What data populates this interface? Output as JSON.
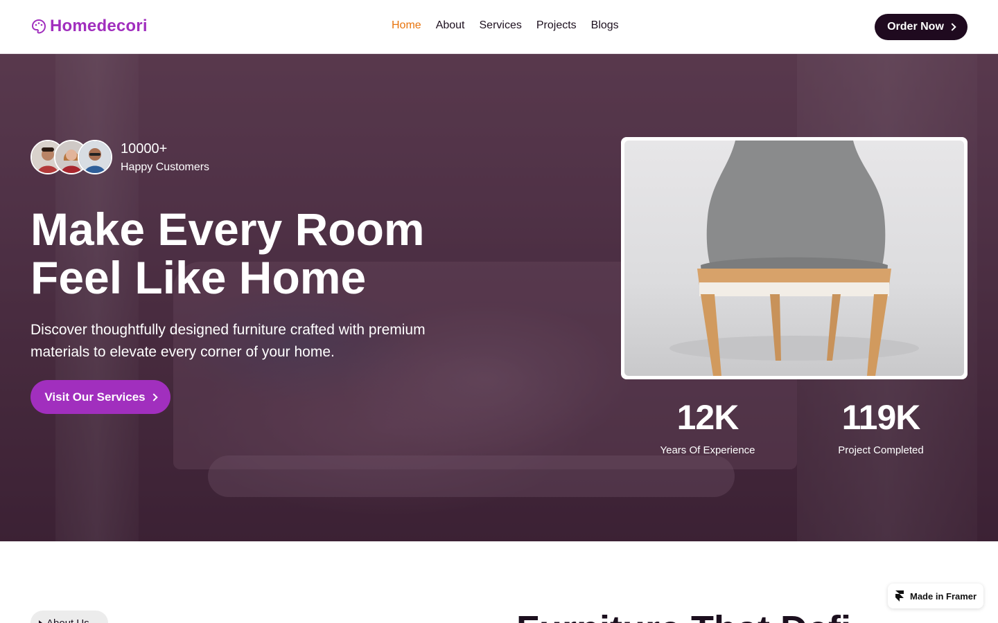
{
  "brand": {
    "name": "Homedecori",
    "accent": "#a12fbe",
    "active_nav": "#e8740d",
    "dark": "#1f0a1f"
  },
  "nav": {
    "items": [
      {
        "label": "Home",
        "active": true
      },
      {
        "label": "About",
        "active": false
      },
      {
        "label": "Services",
        "active": false
      },
      {
        "label": "Projects",
        "active": false
      },
      {
        "label": "Blogs",
        "active": false
      }
    ],
    "order_label": "Order Now"
  },
  "hero": {
    "customers_count": "10000+",
    "customers_label": "Happy Customers",
    "title_line1": "Make Every Room",
    "title_line2": "Feel Like Home",
    "subtitle": "Discover thoughtfully designed furniture crafted with premium materials to elevate every corner of your home.",
    "cta_label": "Visit Our Services",
    "stats": [
      {
        "value": "12K",
        "label": "Years Of Experience"
      },
      {
        "value": "119K",
        "label": "Project Completed"
      }
    ]
  },
  "about": {
    "pill_label": "About Us",
    "section_title": "Furniture That Defi"
  },
  "badge": {
    "label": "Made in Framer"
  },
  "icons": [
    "palette-icon",
    "chevron-right-icon",
    "framer-icon"
  ]
}
